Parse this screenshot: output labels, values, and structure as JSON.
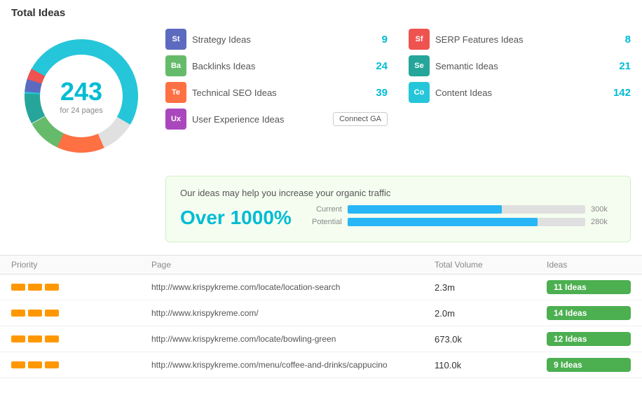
{
  "title": "Total Ideas",
  "donut": {
    "number": "243",
    "subtitle": "for 24 pages"
  },
  "idea_categories": [
    {
      "badge": "St",
      "label": "Strategy Ideas",
      "count": "9",
      "color": "#5c6bc0"
    },
    {
      "badge": "Sf",
      "label": "SERP Features Ideas",
      "count": "8",
      "color": "#ef5350"
    },
    {
      "badge": "Ba",
      "label": "Backlinks Ideas",
      "count": "24",
      "color": "#66bb6a"
    },
    {
      "badge": "Se",
      "label": "Semantic Ideas",
      "count": "21",
      "color": "#26a69a"
    },
    {
      "badge": "Te",
      "label": "Technical SEO Ideas",
      "count": "39",
      "color": "#ff7043"
    },
    {
      "badge": "Co",
      "label": "Content Ideas",
      "count": "142",
      "color": "#26c6da"
    },
    {
      "badge": "Ux",
      "label": "User Experience Ideas",
      "count": "",
      "color": "#ab47bc",
      "hasButton": true
    }
  ],
  "connect_btn_label": "Connect GA",
  "traffic": {
    "title": "Our ideas may help you increase your organic traffic",
    "percent": "Over 1000%",
    "bars": [
      {
        "label": "Current",
        "value": "300k",
        "width": 65
      },
      {
        "label": "Potential",
        "value": "280k",
        "width": 80
      }
    ]
  },
  "table": {
    "headers": [
      "Priority",
      "Page",
      "Total Volume",
      "Ideas"
    ],
    "rows": [
      {
        "url": "http://www.krispykreme.com/locate/location-search",
        "volume": "2.3m",
        "ideas": "11 Ideas"
      },
      {
        "url": "http://www.krispykreme.com/",
        "volume": "2.0m",
        "ideas": "14 Ideas"
      },
      {
        "url": "http://www.krispykreme.com/locate/bowling-green",
        "volume": "673.0k",
        "ideas": "12 Ideas"
      },
      {
        "url": "http://www.krispykreme.com/menu/coffee-and-drinks/cappucino",
        "volume": "110.0k",
        "ideas": "9 Ideas"
      }
    ]
  }
}
